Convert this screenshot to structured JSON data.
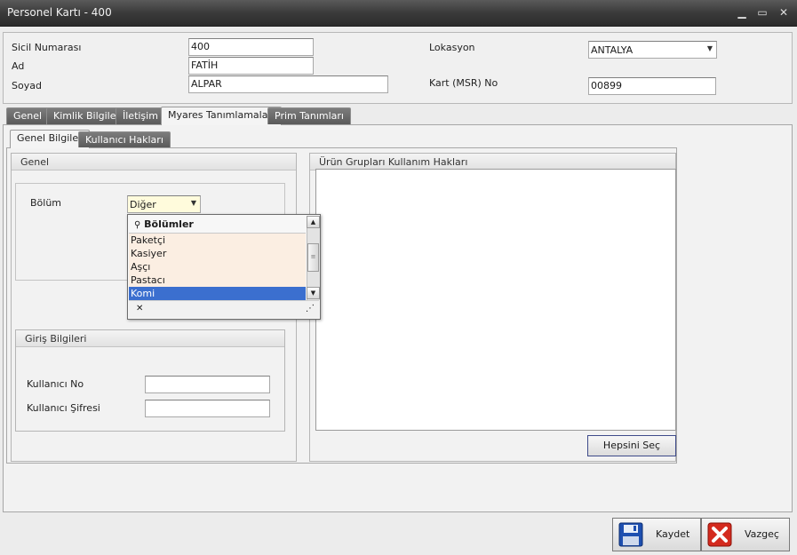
{
  "window": {
    "title": "Personel Kartı - 400",
    "min_glyph": "▁",
    "max_glyph": "▭",
    "close_glyph": "✕"
  },
  "header": {
    "sicil_label": "Sicil Numarası",
    "sicil_value": "400",
    "ad_label": "Ad",
    "ad_value": "FATİH",
    "soyad_label": "Soyad",
    "soyad_value": "ALPAR",
    "lokasyon_label": "Lokasyon",
    "lokasyon_value": "ANTALYA",
    "kart_label": "Kart (MSR) No",
    "kart_value": "00899"
  },
  "tabs": [
    {
      "label": "Genel"
    },
    {
      "label": "Kimlik Bilgileri"
    },
    {
      "label": "İletişim"
    },
    {
      "label": "Myares Tanımlamaları"
    },
    {
      "label": "Prim Tanımları"
    }
  ],
  "subtabs": [
    {
      "label": "Genel Bilgiler"
    },
    {
      "label": "Kullanıcı Hakları"
    }
  ],
  "genel_group": {
    "title": "Genel",
    "bolum_label": "Bölüm",
    "bolum_value": "Diğer"
  },
  "dropdown": {
    "header": "Bölümler",
    "items": [
      "Paketçi",
      "Kasiyer",
      "Aşçı",
      "Pastacı",
      "Komi"
    ],
    "selected_index": 4,
    "clear_glyph": "✕",
    "grip_glyph": "⋰"
  },
  "giris_group": {
    "title": "Giriş Bilgileri",
    "kullanici_no_label": "Kullanıcı No",
    "kullanici_no_value": "",
    "kullanici_sifre_label": "Kullanıcı Şifresi",
    "kullanici_sifre_value": ""
  },
  "urun_group": {
    "title": "Ürün Grupları Kullanım Hakları",
    "select_all_label": "Hepsini Seç"
  },
  "footer": {
    "save_label": "Kaydet",
    "cancel_label": "Vazgeç"
  },
  "colors": {
    "selection": "#3b6fcf",
    "dropdown_item_bg": "#fbeee2",
    "save_icon": "#1e4fb0",
    "cancel_icon": "#d42a1e"
  }
}
